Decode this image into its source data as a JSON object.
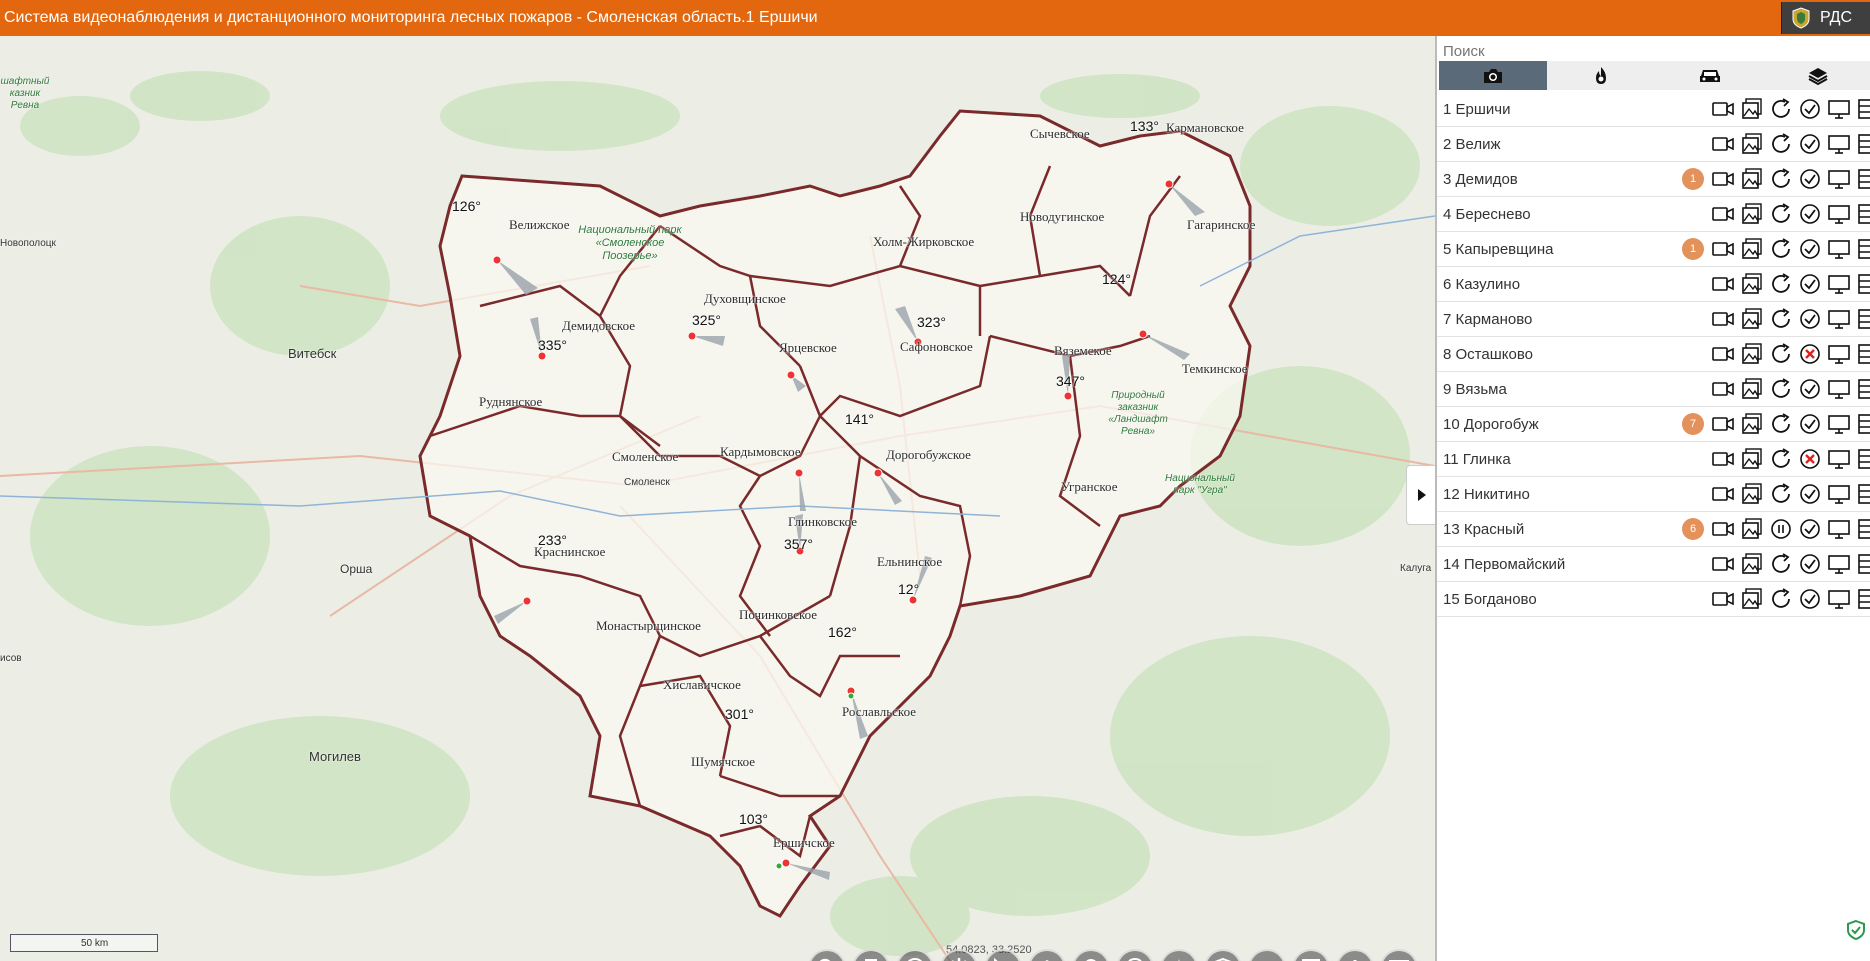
{
  "app": {
    "title": "Система видеонаблюдения и дистанционного мониторинга лесных пожаров - Смоленская область.1 Ершичи",
    "brand": "РДС"
  },
  "colors": {
    "header": "#e3670e",
    "border": "#7a2a2a",
    "badge": "#e2925a",
    "tab_active": "#5a6a78"
  },
  "panel": {
    "search_placeholder": "Поиск",
    "tabs": [
      {
        "icon": "camera-icon",
        "active": true
      },
      {
        "icon": "fire-icon",
        "active": false
      },
      {
        "icon": "car-icon",
        "active": false
      },
      {
        "icon": "layers-icon",
        "active": false
      }
    ],
    "cameras": [
      {
        "name": "1 Ершичи",
        "badge": "",
        "status": "ok",
        "mode": "refresh"
      },
      {
        "name": "2 Велиж",
        "badge": "",
        "status": "ok",
        "mode": "refresh"
      },
      {
        "name": "3 Демидов",
        "badge": "1",
        "status": "ok",
        "mode": "refresh"
      },
      {
        "name": "4 Береснево",
        "badge": "",
        "status": "ok",
        "mode": "refresh"
      },
      {
        "name": "5 Капыревщина",
        "badge": "1",
        "status": "ok",
        "mode": "refresh"
      },
      {
        "name": "6 Казулино",
        "badge": "",
        "status": "ok",
        "mode": "refresh"
      },
      {
        "name": "7 Карманово",
        "badge": "",
        "status": "ok",
        "mode": "refresh"
      },
      {
        "name": "8 Осташково",
        "badge": "",
        "status": "error",
        "mode": "refresh"
      },
      {
        "name": "9 Вязьма",
        "badge": "",
        "status": "ok",
        "mode": "refresh"
      },
      {
        "name": "10 Дорогобуж",
        "badge": "7",
        "status": "ok",
        "mode": "refresh"
      },
      {
        "name": "11 Глинка",
        "badge": "",
        "status": "error",
        "mode": "refresh"
      },
      {
        "name": "12 Никитино",
        "badge": "",
        "status": "ok",
        "mode": "refresh"
      },
      {
        "name": "13 Красный",
        "badge": "6",
        "status": "ok",
        "mode": "pause"
      },
      {
        "name": "14 Первомайский",
        "badge": "",
        "status": "ok",
        "mode": "refresh"
      },
      {
        "name": "15 Богданово",
        "badge": "",
        "status": "ok",
        "mode": "refresh"
      }
    ]
  },
  "map": {
    "districts": [
      "Велижское",
      "Демидовское",
      "Духовщинское",
      "Холм-Жирковское",
      "Сычевское",
      "Кармановское",
      "Новодугинское",
      "Гагаринское",
      "Ярцевское",
      "Сафоновское",
      "Вяземское",
      "Темкинское",
      "Руднянское",
      "Смоленское",
      "Кардымовское",
      "Дорогобужское",
      "Угранское",
      "Глинковское",
      "Ельнинское",
      "Краснинское",
      "Монастырщинское",
      "Починковское",
      "Хиславичское",
      "Рославльское",
      "Шумячское",
      "Ершичское"
    ],
    "cities": [
      "Витебск",
      "Орша",
      "Могилев",
      "Смоленск",
      "Новополоцк",
      "Калуга",
      "исов"
    ],
    "parks": [
      "Национальный парк «Смоленское Поозерье»",
      "Природный заказник «Ландшафт Ревна»",
      "Национальный парк \"Угра\"",
      "шафтный казник Ревна"
    ],
    "angles": [
      "126°",
      "335°",
      "325°",
      "323°",
      "133°",
      "124°",
      "347°",
      "141°",
      "233°",
      "357°",
      "12°",
      "162°",
      "301°",
      "103°"
    ],
    "scale": "50 km",
    "coords": "54.0823, 33.2520"
  },
  "toolbar": [
    "search-tool-icon",
    "print-icon",
    "info-icon",
    "settings-icon",
    "measure-icon",
    "layers-icon",
    "camera-rotate-icon",
    "add-point-icon",
    "compass-icon",
    "shield-icon",
    "sound-icon",
    "fullscreen-icon",
    "alert-icon",
    "chat-icon"
  ]
}
